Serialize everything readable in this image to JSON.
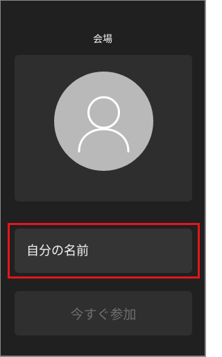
{
  "header": {
    "title": "会場"
  },
  "preview": {
    "avatar_icon": "person-outline-icon"
  },
  "name_field": {
    "placeholder": "自分の名前",
    "value": ""
  },
  "join_button": {
    "label": "今すぐ参加",
    "enabled": false
  },
  "colors": {
    "background": "#202020",
    "card": "#2e2e2e",
    "avatar": "#b9b9b9",
    "highlight": "#e4161b",
    "text": "#f2f2f2",
    "disabled_text": "#6e6e6e"
  }
}
